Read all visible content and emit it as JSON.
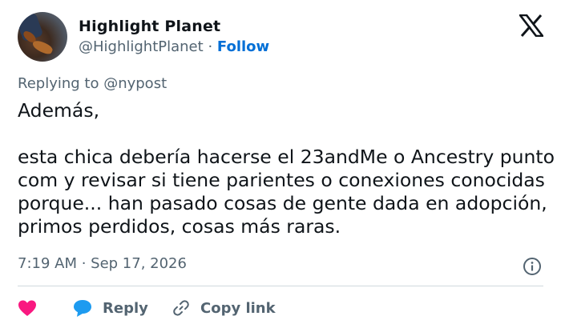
{
  "author": {
    "name": "Highlight Planet",
    "handle": "@HighlightPlanet",
    "separator": "·",
    "follow_label": "Follow"
  },
  "reply_context": "Replying to @nypost",
  "tweet_text": "Además,\n\nesta chica debería hacerse el 23andMe o Ancestry punto com y revisar si tiene parientes o conexiones conocidas porque... han pasado cosas de gente dada en adopción, primos perdidos, cosas más raras.",
  "timestamp": "7:19 AM · Sep 17, 2026",
  "actions": {
    "reply_label": "Reply",
    "copy_link_label": "Copy link"
  },
  "icons": {
    "brand": "x-logo-icon",
    "like": "heart-icon",
    "reply": "reply-bubble-icon",
    "copy": "link-icon",
    "info": "info-icon"
  },
  "colors": {
    "follow": "#006fd6",
    "heart": "#f91880",
    "reply_bubble": "#1d9bf0",
    "muted_text": "#536471"
  }
}
